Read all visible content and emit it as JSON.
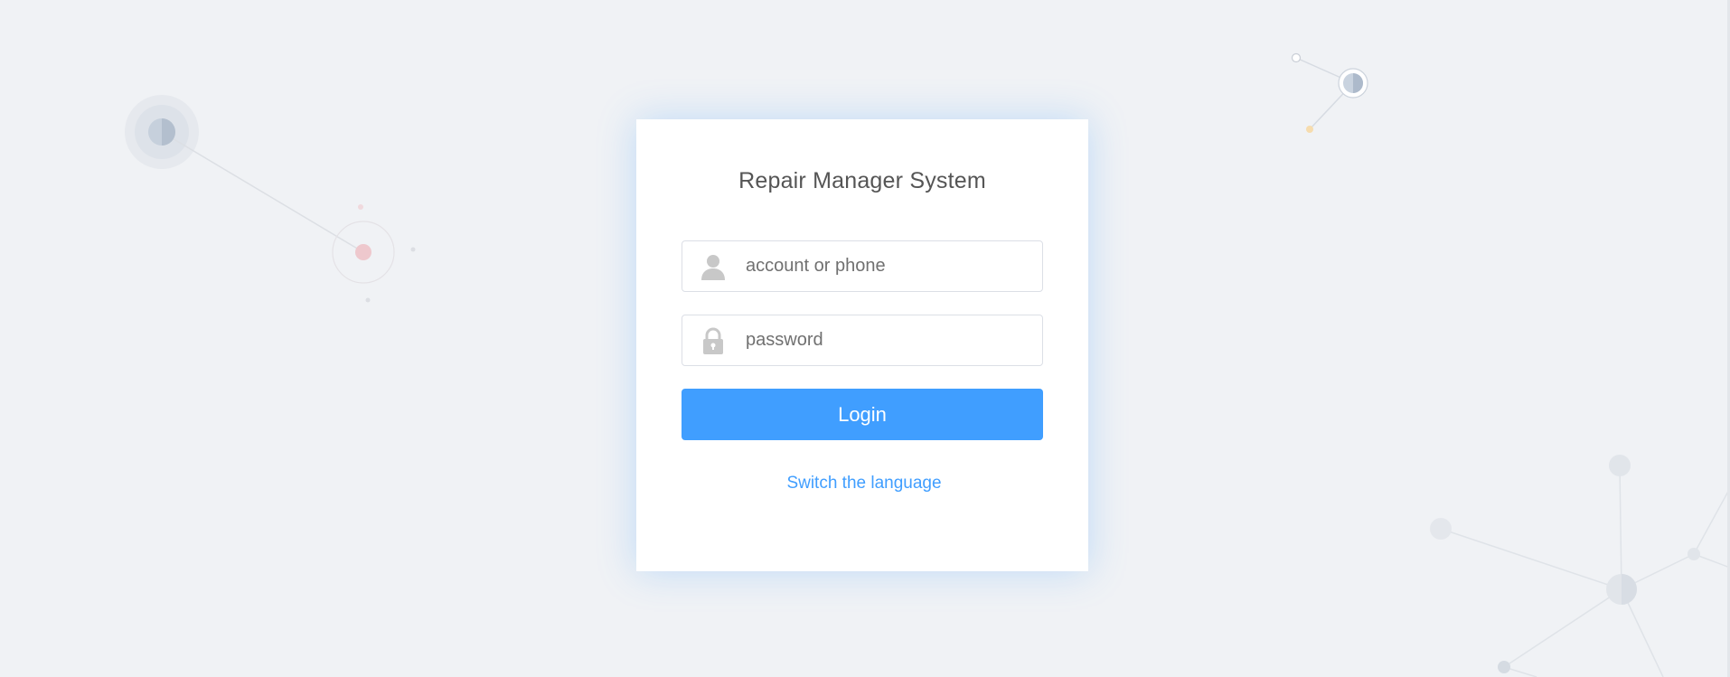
{
  "app": {
    "title": "Repair Manager System"
  },
  "form": {
    "account": {
      "placeholder": "account or phone",
      "value": "",
      "icon": "user-icon"
    },
    "password": {
      "placeholder": "password",
      "value": "",
      "icon": "lock-icon"
    },
    "login_label": "Login",
    "switch_language_label": "Switch the language"
  },
  "colors": {
    "background": "#f0f2f5",
    "card": "#ffffff",
    "accent": "#409eff",
    "title_text": "#555555",
    "input_border": "#dcdfe6"
  }
}
